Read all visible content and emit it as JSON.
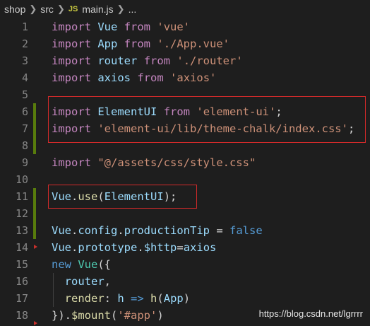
{
  "breadcrumb": {
    "items": [
      "shop",
      "src",
      "main.js",
      "..."
    ],
    "file_badge": "JS"
  },
  "lines": [
    {
      "n": "1",
      "tokens": [
        [
          "kw",
          "import"
        ],
        [
          "pl",
          " "
        ],
        [
          "id",
          "Vue"
        ],
        [
          "pl",
          " "
        ],
        [
          "kw",
          "from"
        ],
        [
          "pl",
          " "
        ],
        [
          "str",
          "'vue'"
        ]
      ]
    },
    {
      "n": "2",
      "tokens": [
        [
          "kw",
          "import"
        ],
        [
          "pl",
          " "
        ],
        [
          "id",
          "App"
        ],
        [
          "pl",
          " "
        ],
        [
          "kw",
          "from"
        ],
        [
          "pl",
          " "
        ],
        [
          "str",
          "'./App.vue'"
        ]
      ]
    },
    {
      "n": "3",
      "tokens": [
        [
          "kw",
          "import"
        ],
        [
          "pl",
          " "
        ],
        [
          "id",
          "router"
        ],
        [
          "pl",
          " "
        ],
        [
          "kw",
          "from"
        ],
        [
          "pl",
          " "
        ],
        [
          "str",
          "'./router'"
        ]
      ]
    },
    {
      "n": "4",
      "tokens": [
        [
          "kw",
          "import"
        ],
        [
          "pl",
          " "
        ],
        [
          "id",
          "axios"
        ],
        [
          "pl",
          " "
        ],
        [
          "kw",
          "from"
        ],
        [
          "pl",
          " "
        ],
        [
          "str",
          "'axios'"
        ]
      ]
    },
    {
      "n": "5",
      "tokens": []
    },
    {
      "n": "6",
      "tokens": [
        [
          "kw",
          "import"
        ],
        [
          "pl",
          " "
        ],
        [
          "id",
          "ElementUI"
        ],
        [
          "pl",
          " "
        ],
        [
          "kw",
          "from"
        ],
        [
          "pl",
          " "
        ],
        [
          "str",
          "'element-ui'"
        ],
        [
          "pl",
          ";"
        ]
      ]
    },
    {
      "n": "7",
      "tokens": [
        [
          "kw",
          "import"
        ],
        [
          "pl",
          " "
        ],
        [
          "str",
          "'element-ui/lib/theme-chalk/index.css'"
        ],
        [
          "pl",
          ";"
        ]
      ]
    },
    {
      "n": "8",
      "tokens": []
    },
    {
      "n": "9",
      "tokens": [
        [
          "kw",
          "import"
        ],
        [
          "pl",
          " "
        ],
        [
          "str",
          "\"@/assets/css/style.css\""
        ]
      ]
    },
    {
      "n": "10",
      "tokens": []
    },
    {
      "n": "11",
      "tokens": [
        [
          "id",
          "Vue"
        ],
        [
          "pl",
          "."
        ],
        [
          "fn",
          "use"
        ],
        [
          "pl",
          "("
        ],
        [
          "id",
          "ElementUI"
        ],
        [
          "pl",
          ");"
        ]
      ]
    },
    {
      "n": "12",
      "tokens": []
    },
    {
      "n": "13",
      "tokens": [
        [
          "id",
          "Vue"
        ],
        [
          "pl",
          "."
        ],
        [
          "id",
          "config"
        ],
        [
          "pl",
          "."
        ],
        [
          "id",
          "productionTip"
        ],
        [
          "pl",
          " = "
        ],
        [
          "kw2",
          "false"
        ]
      ]
    },
    {
      "n": "14",
      "tokens": [
        [
          "id",
          "Vue"
        ],
        [
          "pl",
          "."
        ],
        [
          "id",
          "prototype"
        ],
        [
          "pl",
          "."
        ],
        [
          "id",
          "$http"
        ],
        [
          "pl",
          "="
        ],
        [
          "id",
          "axios"
        ]
      ]
    },
    {
      "n": "15",
      "tokens": [
        [
          "kw2",
          "new"
        ],
        [
          "pl",
          " "
        ],
        [
          "ty",
          "Vue"
        ],
        [
          "pl",
          "({"
        ]
      ]
    },
    {
      "n": "16",
      "tokens": [
        [
          "pl",
          "  "
        ],
        [
          "id",
          "router"
        ],
        [
          "pl",
          ","
        ]
      ]
    },
    {
      "n": "17",
      "tokens": [
        [
          "pl",
          "  "
        ],
        [
          "fn",
          "render"
        ],
        [
          "pl",
          ": "
        ],
        [
          "id",
          "h"
        ],
        [
          "pl",
          " "
        ],
        [
          "kw2",
          "=>"
        ],
        [
          "pl",
          " "
        ],
        [
          "fn",
          "h"
        ],
        [
          "pl",
          "("
        ],
        [
          "id",
          "App"
        ],
        [
          "pl",
          ")"
        ]
      ]
    },
    {
      "n": "18",
      "tokens": [
        [
          "pl",
          "})."
        ],
        [
          "fn",
          "$mount"
        ],
        [
          "pl",
          "("
        ],
        [
          "str",
          "'#app'"
        ],
        [
          "pl",
          ")"
        ]
      ]
    }
  ],
  "watermark": "https://blog.csdn.net/lgrrrr",
  "colors": {
    "background": "#1e1e1e",
    "keyword": "#c586c0",
    "string": "#ce9178",
    "identifier": "#9cdcfe",
    "highlight_box": "#d22a2a",
    "gutter_added": "#587c0c"
  }
}
